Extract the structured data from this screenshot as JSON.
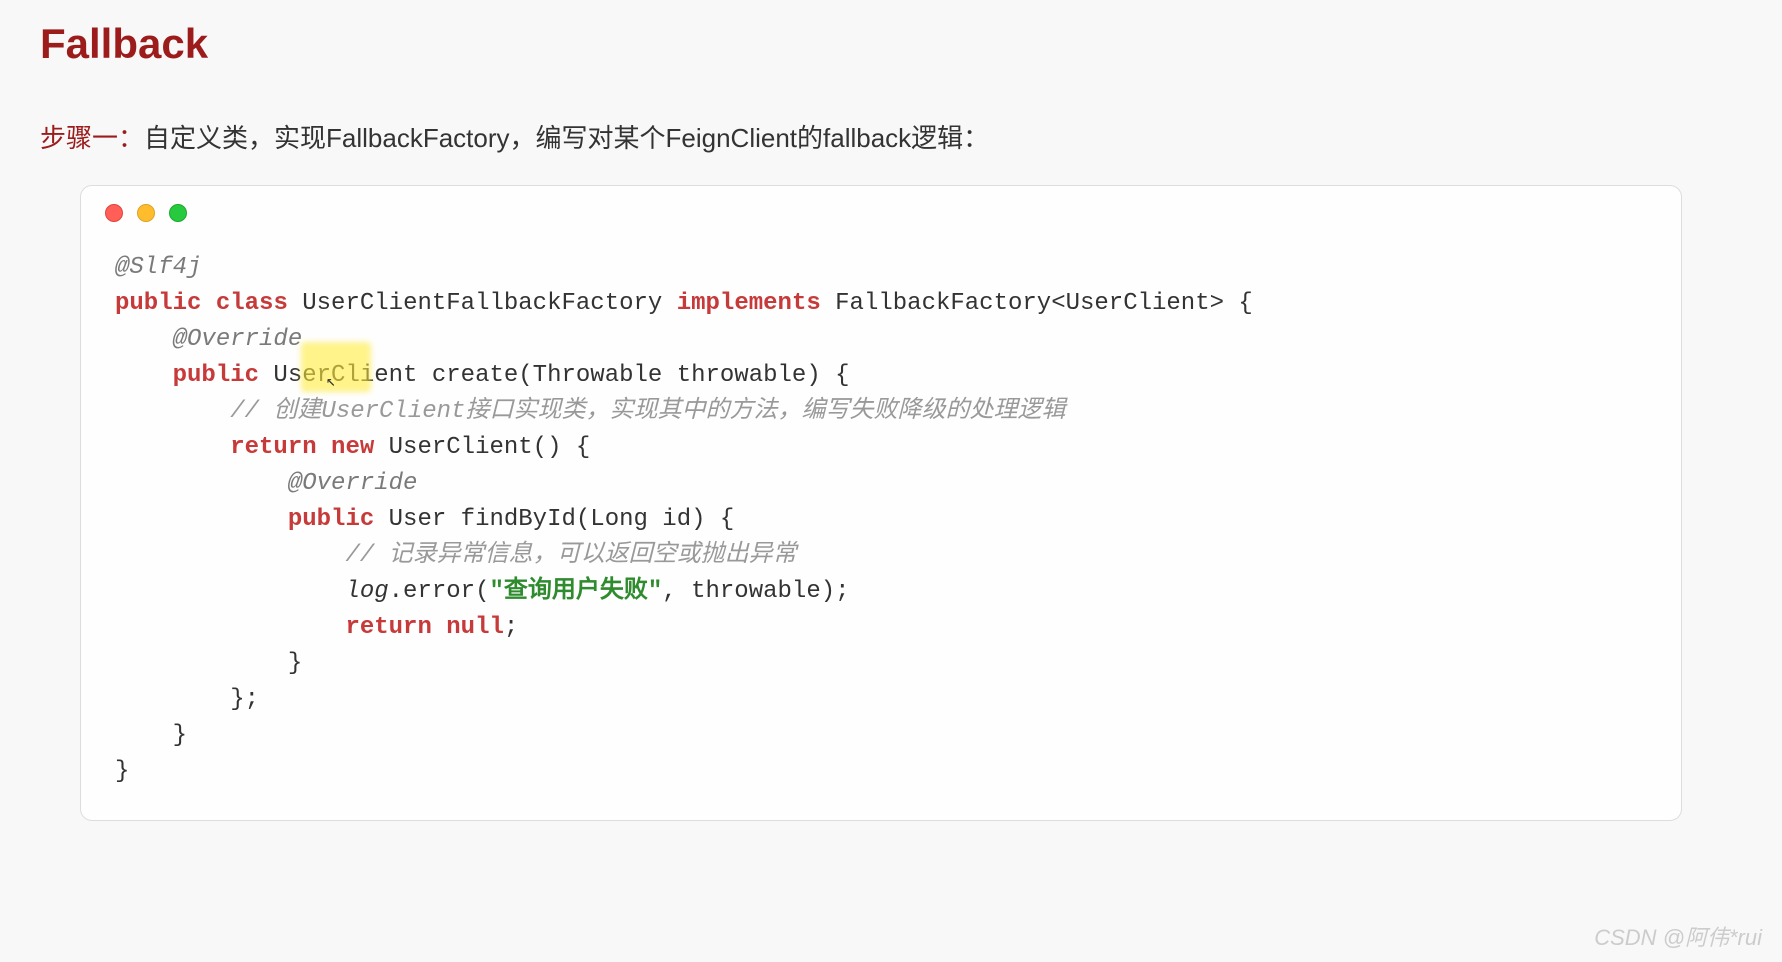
{
  "title": "Fallback",
  "step": {
    "label": "步骤一：",
    "text": "自定义类，实现FallbackFactory，编写对某个FeignClient的fallback逻辑："
  },
  "code": {
    "line1_annotation": "@Slf4j",
    "line2_kw_public": "public",
    "line2_kw_class": "class",
    "line2_classname": " UserClientFallbackFactory ",
    "line2_kw_implements": "implements",
    "line2_rest": " FallbackFactory<UserClient> {",
    "line3_annotation": "    @Override",
    "line4_kw_public": "    public",
    "line4_rest": " UserClient create(Throwable throwable) {",
    "line5_comment": "        // 创建UserClient接口实现类，实现其中的方法，编写失败降级的处理逻辑",
    "line6_kw_return": "        return",
    "line6_kw_new": " new",
    "line6_rest": " UserClient() {",
    "line7_annotation": "            @Override",
    "line8_kw_public": "            public",
    "line8_rest": " User findById(Long id) {",
    "line9_comment": "                // 记录异常信息，可以返回空或抛出异常",
    "line10_log": "                log",
    "line10_error": ".error(",
    "line10_string": "\"查询用户失败\"",
    "line10_rest": ", throwable);",
    "line11_kw_return": "                return",
    "line11_kw_null": " null",
    "line11_rest": ";",
    "line12": "            }",
    "line13": "        };",
    "line14": "    }",
    "line15": "}"
  },
  "watermark": "CSDN @阿伟*rui"
}
